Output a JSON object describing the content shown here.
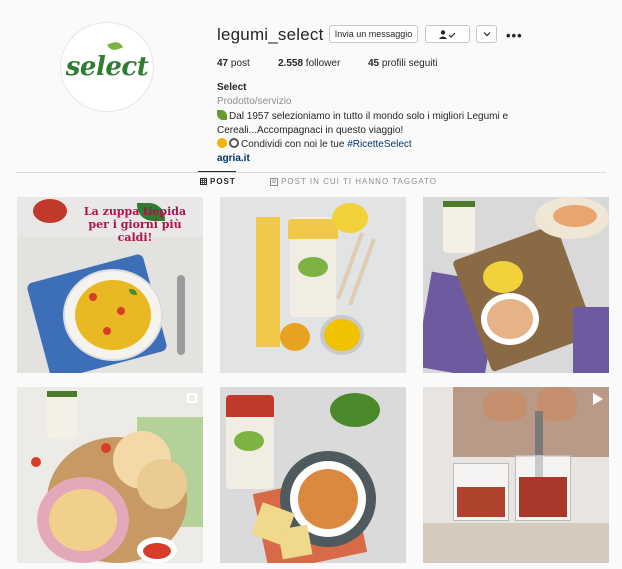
{
  "profile": {
    "username": "legumi_select",
    "logo_text": "select",
    "buttons": {
      "message": "Invia un messaggio",
      "follow_icon": "person-check-icon",
      "chevron_icon": "chevron-down-icon",
      "more": "•••"
    },
    "stats": {
      "posts_count": "47",
      "posts_label": " post",
      "followers_count": "2.558",
      "followers_label": " follower",
      "following_count": "45",
      "following_label": " profili seguiti"
    },
    "bio": {
      "name": "Select",
      "category": "Prodotto/servizio",
      "line1": "Dal 1957 selezioniamo in tutto il mondo solo i migliori Legumi e",
      "line2": "Cereali...Accompagnaci in questo viaggio!",
      "line3_prefix": "Condividi con noi le tue ",
      "line3_hashtag": "#RicetteSelect",
      "link": "agria.it"
    }
  },
  "tabs": {
    "posts": "POST",
    "tagged": "POST IN CUI TI HANNO TAGGATO"
  },
  "posts": [
    {
      "overlay_text": "La zuppa tiepida per i giorni più caldi!",
      "badge": "none"
    },
    {
      "badge": "none"
    },
    {
      "badge": "none"
    },
    {
      "badge": "carousel"
    },
    {
      "badge": "none"
    },
    {
      "badge": "video"
    }
  ],
  "colors": {
    "brand_green": "#2f7d32",
    "post_text": "#b0114d",
    "link": "#003569"
  }
}
